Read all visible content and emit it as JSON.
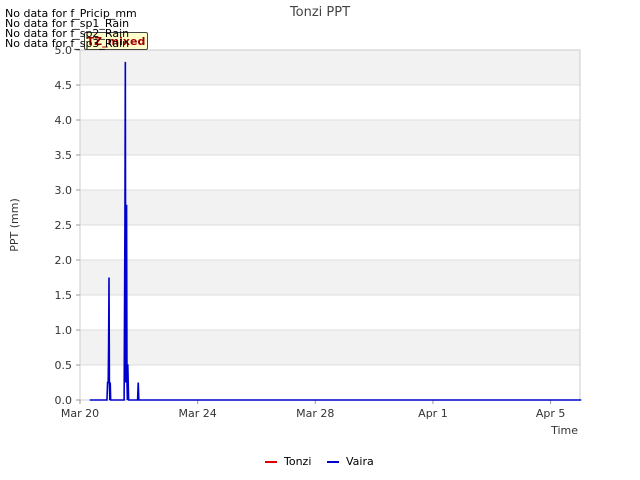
{
  "notices": [
    "No data for f_Pricip_mm",
    "No data for f_sp1_Rain",
    "No data for f_sp2_Rain",
    "No data for f_sp3_Rain"
  ],
  "badge_label": "TZ_mixed",
  "colors": {
    "tonzi": "#dd0000",
    "vaira": "#0000cc",
    "band": "#f2f2f2",
    "grid": "#dddddd"
  },
  "chart_data": {
    "type": "line",
    "title": "Tonzi PPT",
    "xlabel": "Time",
    "ylabel": "PPT (mm)",
    "xlim": [
      "2023-03-20",
      "2023-04-06"
    ],
    "ylim": [
      0,
      5.0
    ],
    "grid": true,
    "legend_position": "bottom",
    "x_ticks": [
      {
        "date": "2023-03-20",
        "label": "Mar 20"
      },
      {
        "date": "2023-03-24",
        "label": "Mar 24"
      },
      {
        "date": "2023-03-28",
        "label": "Mar 28"
      },
      {
        "date": "2023-04-01",
        "label": "Apr 1"
      },
      {
        "date": "2023-04-05",
        "label": "Apr 5"
      }
    ],
    "y_ticks": [
      {
        "value": 0.0,
        "label": "0.0"
      },
      {
        "value": 0.5,
        "label": "0.5"
      },
      {
        "value": 1.0,
        "label": "1.0"
      },
      {
        "value": 1.5,
        "label": "1.5"
      },
      {
        "value": 2.0,
        "label": "2.0"
      },
      {
        "value": 2.5,
        "label": "2.5"
      },
      {
        "value": 3.0,
        "label": "3.0"
      },
      {
        "value": 3.5,
        "label": "3.5"
      },
      {
        "value": 4.0,
        "label": "4.0"
      },
      {
        "value": 4.5,
        "label": "4.5"
      },
      {
        "value": 5.0,
        "label": "5.0"
      }
    ],
    "series": [
      {
        "name": "Tonzi",
        "color": "#dd0000",
        "points": []
      },
      {
        "name": "Vaira",
        "color": "#0000cc",
        "points": [
          [
            "2023-03-20 08:00",
            0.0
          ],
          [
            "2023-03-20 22:00",
            0.0
          ],
          [
            "2023-03-20 22:30",
            0.25
          ],
          [
            "2023-03-20 23:00",
            0.25
          ],
          [
            "2023-03-20 23:20",
            0.75
          ],
          [
            "2023-03-20 23:40",
            1.75
          ],
          [
            "2023-03-21 00:00",
            0.25
          ],
          [
            "2023-03-21 00:20",
            0.0
          ],
          [
            "2023-03-21 00:40",
            0.25
          ],
          [
            "2023-03-21 01:00",
            0.0
          ],
          [
            "2023-03-21 12:00",
            0.0
          ],
          [
            "2023-03-21 12:40",
            2.5
          ],
          [
            "2023-03-21 13:00",
            4.83
          ],
          [
            "2023-03-21 13:20",
            0.25
          ],
          [
            "2023-03-21 13:40",
            0.75
          ],
          [
            "2023-03-21 14:00",
            2.79
          ],
          [
            "2023-03-21 14:20",
            0.25
          ],
          [
            "2023-03-21 14:40",
            0.0
          ],
          [
            "2023-03-21 15:00",
            0.51
          ],
          [
            "2023-03-21 15:20",
            0.25
          ],
          [
            "2023-03-21 15:40",
            0.0
          ],
          [
            "2023-03-21 23:00",
            0.0
          ],
          [
            "2023-03-21 23:30",
            0.25
          ],
          [
            "2023-03-22 00:00",
            0.0
          ],
          [
            "2023-04-06 01:00",
            0.0
          ]
        ]
      }
    ]
  }
}
